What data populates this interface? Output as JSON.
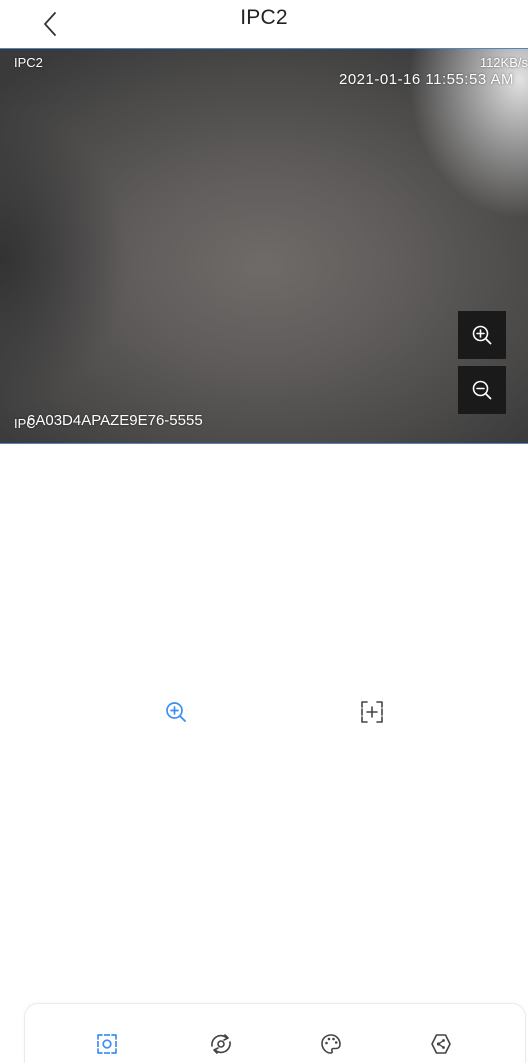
{
  "header": {
    "title": "IPC2",
    "back_icon": "chevron-left-icon"
  },
  "video": {
    "channel_label": "IPC2",
    "bitrate": "112KB/s",
    "timestamp": "2021-01-16 11:55:53 AM",
    "osd_name": "IPC",
    "device_id": "6A03D4APAZE9E76-5555",
    "zoom_in_icon": "zoom-in-icon",
    "zoom_out_icon": "zoom-out-icon"
  },
  "controls": {
    "zoom_icon": "zoom-in-icon",
    "fit_icon": "fit-screen-icon"
  },
  "toolbar": {
    "items": [
      {
        "icon": "screenshot-icon",
        "active": true
      },
      {
        "icon": "ptz-rotate-icon",
        "active": false
      },
      {
        "icon": "color-palette-icon",
        "active": false
      },
      {
        "icon": "preset-point-icon",
        "active": false
      }
    ]
  },
  "colors": {
    "accent": "#3d8ff2",
    "icon_gray": "#444444",
    "video_border": "#4f86c6",
    "zoom_button_bg": "#1a1a1a"
  }
}
